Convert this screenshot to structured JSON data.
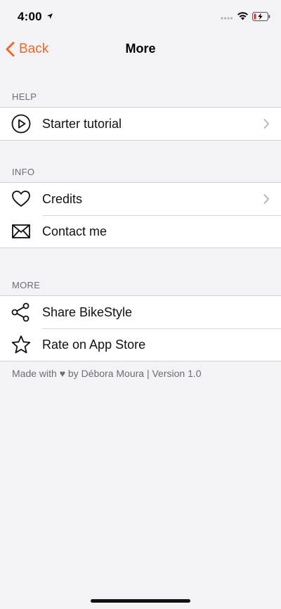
{
  "status_bar": {
    "time": "4:00",
    "icons": [
      "location-arrow-icon",
      "signal-dots-icon",
      "wifi-icon",
      "battery-charging-icon"
    ]
  },
  "nav": {
    "back_label": "Back",
    "title": "More",
    "accent_color": "#f26722"
  },
  "sections": {
    "help": {
      "header": "HELP",
      "items": [
        {
          "label": "Starter tutorial",
          "icon": "play-circle-icon",
          "has_chevron": true
        }
      ]
    },
    "info": {
      "header": "INFO",
      "items": [
        {
          "label": "Credits",
          "icon": "heart-icon",
          "has_chevron": true
        },
        {
          "label": "Contact me",
          "icon": "envelope-icon",
          "has_chevron": false
        }
      ]
    },
    "more": {
      "header": "MORE",
      "items": [
        {
          "label": "Share BikeStyle",
          "icon": "share-icon",
          "has_chevron": false
        },
        {
          "label": "Rate on App Store",
          "icon": "star-icon",
          "has_chevron": false
        }
      ]
    }
  },
  "footer": {
    "text": "Made with ♥ by Débora Moura | Version 1.0"
  }
}
